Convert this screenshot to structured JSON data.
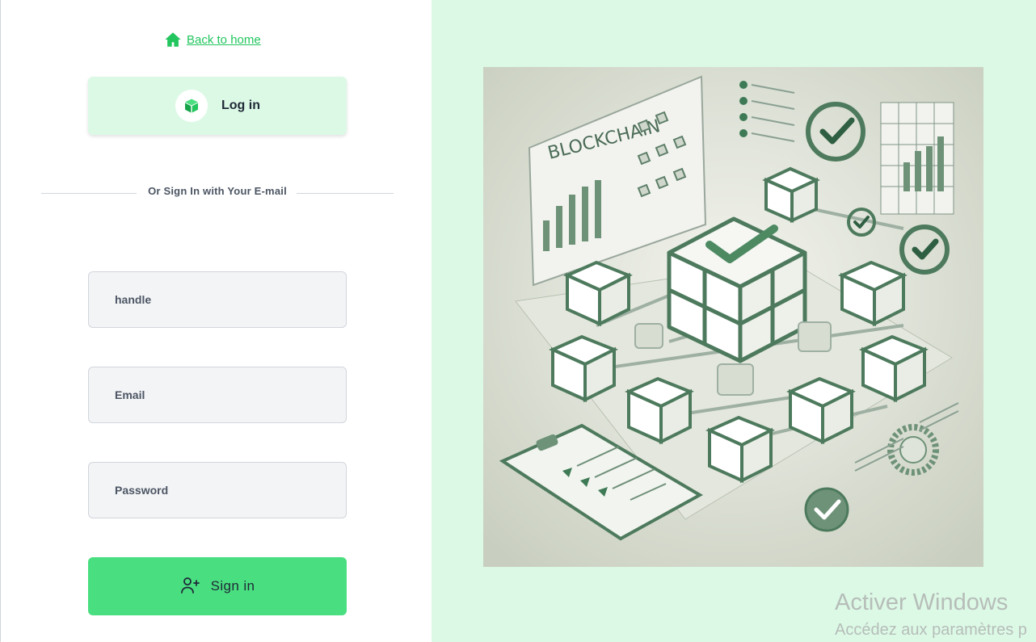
{
  "nav": {
    "back_label": "Back to home",
    "back_icon": "home-icon"
  },
  "login_button": {
    "label": "Log in",
    "icon": "cube-icon"
  },
  "divider": {
    "text": "Or Sign In with Your E-mail"
  },
  "form": {
    "handle_placeholder": "handle",
    "email_placeholder": "Email",
    "password_placeholder": "Password",
    "submit_label": "Sign in",
    "submit_icon": "user-plus-icon"
  },
  "illustration": {
    "caption": "BLOCKCHAIN"
  },
  "watermark": {
    "title": "Activer Windows",
    "subtitle": "Accédez aux paramètres p"
  },
  "colors": {
    "accent": "#49de80",
    "accent_light": "#dcf9e6",
    "link": "#22c55e",
    "field_bg": "#f3f4f6"
  }
}
